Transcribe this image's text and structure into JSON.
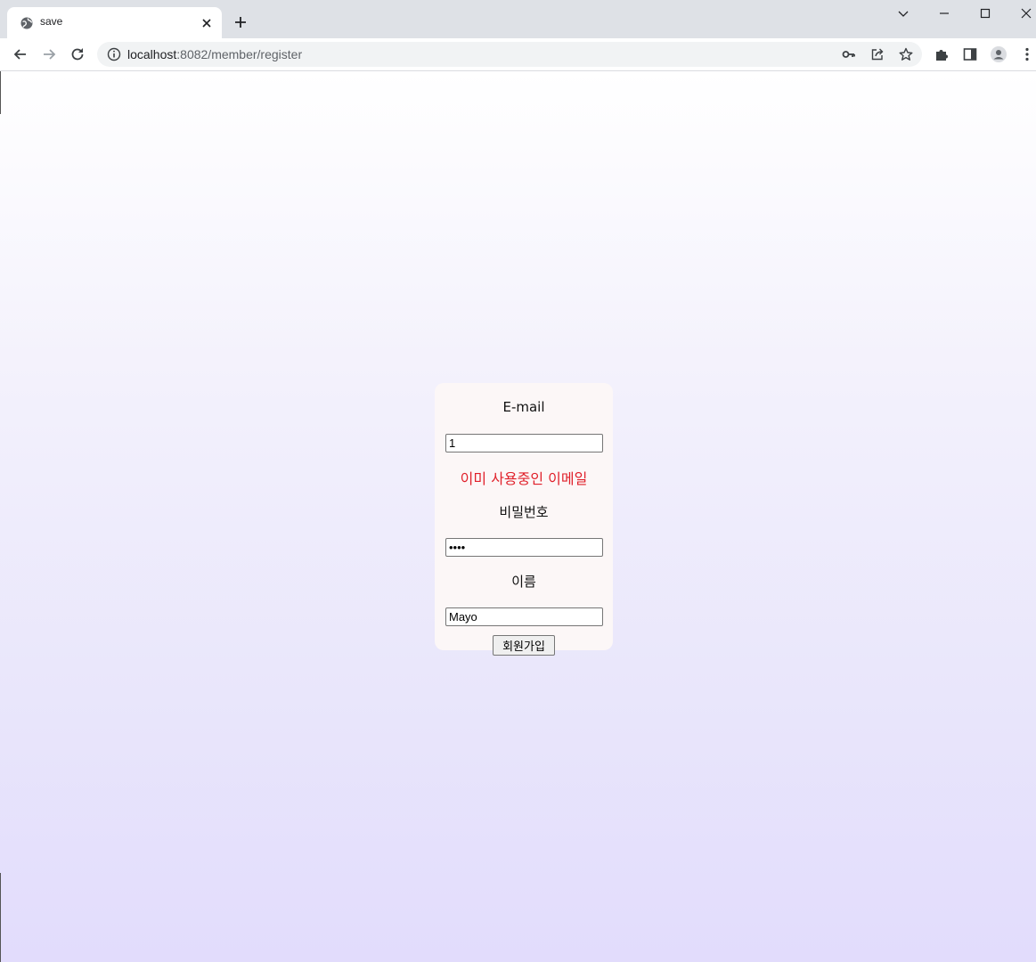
{
  "browser": {
    "tab_title": "save",
    "url_host": "localhost",
    "url_path": ":8082/member/register"
  },
  "icons": {
    "favicon": "globe-icon",
    "tab_close": "close-icon",
    "new_tab": "plus-icon",
    "back": "back-arrow-icon",
    "forward": "forward-arrow-icon",
    "reload": "reload-icon",
    "site_info": "info-icon",
    "password": "key-icon",
    "share": "share-icon",
    "bookmark": "star-icon",
    "extensions": "puzzle-icon",
    "side_panel": "side-panel-icon",
    "profile": "profile-icon",
    "menu": "kebab-menu-icon"
  },
  "form": {
    "email_label": "E-mail",
    "email_value": "1",
    "email_error": "이미 사용중인 이메일",
    "password_label": "비밀번호",
    "password_value": "1234",
    "name_label": "이름",
    "name_value": "Mayo",
    "submit_label": "회원가입"
  },
  "colors": {
    "error": "#e0202a",
    "card": "#fcf7f7",
    "gradient_bottom": "#e2dcfc"
  }
}
